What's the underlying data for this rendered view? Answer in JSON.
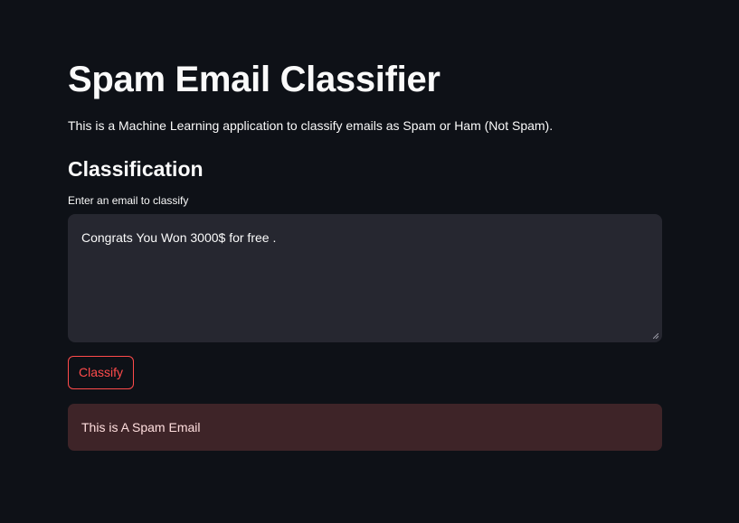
{
  "app": {
    "title": "Spam Email Classifier",
    "description": "This is a Machine Learning application to classify emails as Spam or Ham (Not Spam)."
  },
  "classification": {
    "heading": "Classification",
    "input_label": "Enter an email to classify",
    "input_value": "Congrats You Won 3000$ for free .",
    "button_label": "Classify",
    "result_text": "This is A Spam Email"
  },
  "colors": {
    "background": "#0e1117",
    "input_background": "#262730",
    "accent": "#ff4b4b",
    "error_background": "#3e2428",
    "text": "#fafafa"
  },
  "icons": {
    "resize_handle": "resize-grip-icon"
  }
}
